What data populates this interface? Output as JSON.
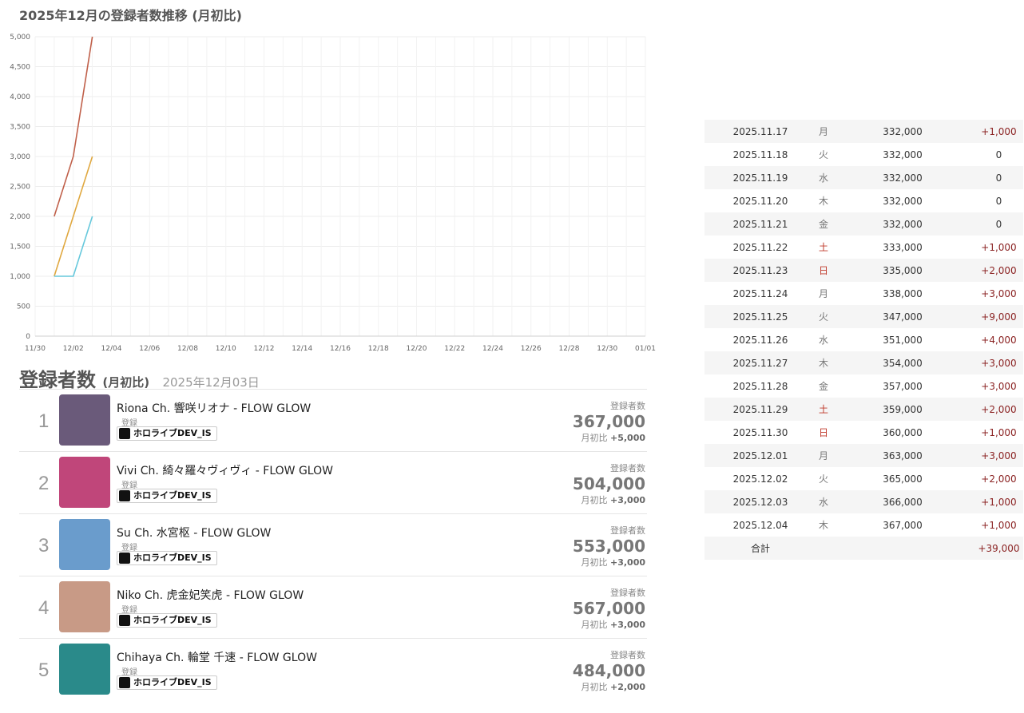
{
  "chart_title": "2025年12月の登録者数推移 (月初比)",
  "chart_data": {
    "type": "line",
    "title": "2025年12月の登録者数推移 (月初比)",
    "x_ticks": [
      "11/30",
      "12/02",
      "12/04",
      "12/06",
      "12/08",
      "12/10",
      "12/12",
      "12/14",
      "12/16",
      "12/18",
      "12/20",
      "12/22",
      "12/24",
      "12/26",
      "12/28",
      "12/30",
      "01/01"
    ],
    "y_ticks": [
      "0",
      "500",
      "1,000",
      "1,500",
      "2,000",
      "2,500",
      "3,000",
      "3,500",
      "4,000",
      "4,500",
      "5,000"
    ],
    "ylim": [
      0,
      5000
    ],
    "xlim": [
      "2025-11-30",
      "2026-01-01"
    ],
    "grid": true,
    "series": [
      {
        "color": "#c0604a",
        "points": [
          [
            "2025-12-01",
            2000
          ],
          [
            "2025-12-02",
            3000
          ],
          [
            "2025-12-03",
            5000
          ]
        ]
      },
      {
        "color": "#e0a840",
        "points": [
          [
            "2025-12-01",
            1000
          ],
          [
            "2025-12-02",
            2000
          ],
          [
            "2025-12-03",
            3000
          ]
        ]
      },
      {
        "color": "#66c8dc",
        "points": [
          [
            "2025-12-01",
            1000
          ],
          [
            "2025-12-02",
            1000
          ],
          [
            "2025-12-03",
            2000
          ]
        ]
      }
    ]
  },
  "ranking": {
    "title": "登録者数",
    "subtitle": "(月初比)",
    "date": "2025年12月03日",
    "subs_label": "登録者数",
    "diff_label": "月初比",
    "reg_label": "登録",
    "items": [
      {
        "rank": "1",
        "name": "Riona Ch. 響咲リオナ - FLOW GLOW",
        "group": "ホロライブDEV_IS",
        "subs": "367,000",
        "diff": "+5,000",
        "avatar_color": "#6a5a7a"
      },
      {
        "rank": "2",
        "name": "Vivi Ch. 綺々羅々ヴィヴィ - FLOW GLOW",
        "group": "ホロライブDEV_IS",
        "subs": "504,000",
        "diff": "+3,000",
        "avatar_color": "#c0467a"
      },
      {
        "rank": "3",
        "name": "Su Ch. 水宮枢 - FLOW GLOW",
        "group": "ホロライブDEV_IS",
        "subs": "553,000",
        "diff": "+3,000",
        "avatar_color": "#6a9ccc"
      },
      {
        "rank": "4",
        "name": "Niko Ch. 虎金妃笑虎 - FLOW GLOW",
        "group": "ホロライブDEV_IS",
        "subs": "567,000",
        "diff": "+3,000",
        "avatar_color": "#c89a86"
      },
      {
        "rank": "5",
        "name": "Chihaya Ch. 輪堂 千速 - FLOW GLOW",
        "group": "ホロライブDEV_IS",
        "subs": "484,000",
        "diff": "+2,000",
        "avatar_color": "#2a8a8a"
      }
    ]
  },
  "daily": {
    "rows": [
      {
        "date": "2025.11.17",
        "wd": "月",
        "red": false,
        "val": "332,000",
        "diff": "+1,000"
      },
      {
        "date": "2025.11.18",
        "wd": "火",
        "red": false,
        "val": "332,000",
        "diff": "0"
      },
      {
        "date": "2025.11.19",
        "wd": "水",
        "red": false,
        "val": "332,000",
        "diff": "0"
      },
      {
        "date": "2025.11.20",
        "wd": "木",
        "red": false,
        "val": "332,000",
        "diff": "0"
      },
      {
        "date": "2025.11.21",
        "wd": "金",
        "red": false,
        "val": "332,000",
        "diff": "0"
      },
      {
        "date": "2025.11.22",
        "wd": "土",
        "red": true,
        "val": "333,000",
        "diff": "+1,000"
      },
      {
        "date": "2025.11.23",
        "wd": "日",
        "red": true,
        "val": "335,000",
        "diff": "+2,000"
      },
      {
        "date": "2025.11.24",
        "wd": "月",
        "red": false,
        "val": "338,000",
        "diff": "+3,000"
      },
      {
        "date": "2025.11.25",
        "wd": "火",
        "red": false,
        "val": "347,000",
        "diff": "+9,000"
      },
      {
        "date": "2025.11.26",
        "wd": "水",
        "red": false,
        "val": "351,000",
        "diff": "+4,000"
      },
      {
        "date": "2025.11.27",
        "wd": "木",
        "red": false,
        "val": "354,000",
        "diff": "+3,000"
      },
      {
        "date": "2025.11.28",
        "wd": "金",
        "red": false,
        "val": "357,000",
        "diff": "+3,000"
      },
      {
        "date": "2025.11.29",
        "wd": "土",
        "red": true,
        "val": "359,000",
        "diff": "+2,000"
      },
      {
        "date": "2025.11.30",
        "wd": "日",
        "red": true,
        "val": "360,000",
        "diff": "+1,000"
      },
      {
        "date": "2025.12.01",
        "wd": "月",
        "red": false,
        "val": "363,000",
        "diff": "+3,000"
      },
      {
        "date": "2025.12.02",
        "wd": "火",
        "red": false,
        "val": "365,000",
        "diff": "+2,000"
      },
      {
        "date": "2025.12.03",
        "wd": "水",
        "red": false,
        "val": "366,000",
        "diff": "+1,000"
      },
      {
        "date": "2025.12.04",
        "wd": "木",
        "red": false,
        "val": "367,000",
        "diff": "+1,000"
      }
    ],
    "total_label": "合計",
    "total_diff": "+39,000"
  }
}
